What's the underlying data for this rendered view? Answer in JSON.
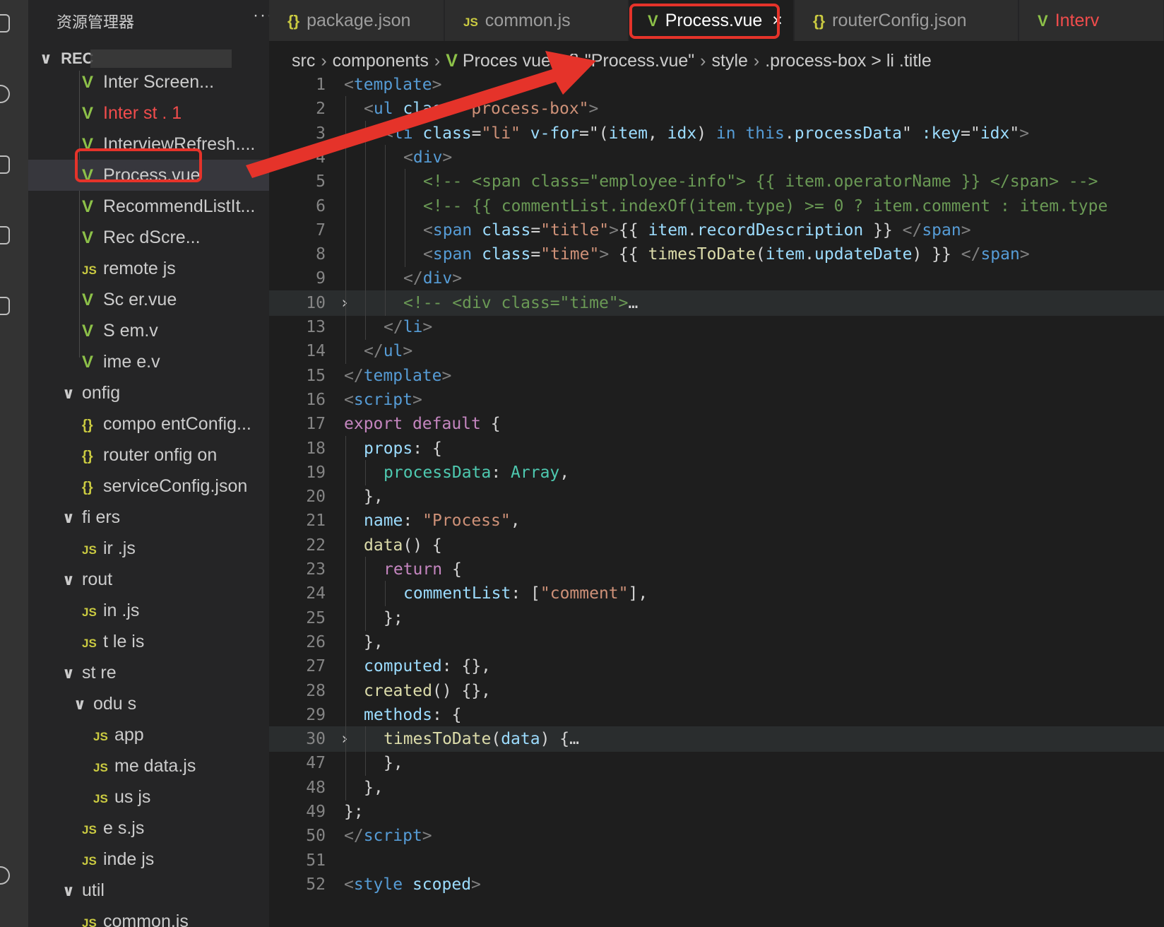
{
  "sidebar": {
    "title": "资源管理器",
    "more": "···",
    "root": "REC",
    "items": [
      {
        "icon": "vue",
        "label": "Inter   Screen...",
        "indent": 1
      },
      {
        "icon": "vue",
        "label": "Inter   st  .  1",
        "indent": 1,
        "error": true
      },
      {
        "icon": "vue",
        "label": "InterviewRefresh....",
        "indent": 1
      },
      {
        "icon": "vue",
        "label": "Process.vue",
        "indent": 1,
        "active": true
      },
      {
        "icon": "vue",
        "label": "RecommendListIt...",
        "indent": 1
      },
      {
        "icon": "vue",
        "label": "Rec   dScre...",
        "indent": 1
      },
      {
        "icon": "js",
        "label": "remote     js",
        "indent": 1
      },
      {
        "icon": "vue",
        "label": "Sc    er.vue",
        "indent": 1
      },
      {
        "icon": "vue",
        "label": "S   em.v",
        "indent": 1
      },
      {
        "icon": "vue",
        "label": "ime    e.v",
        "indent": 1
      },
      {
        "icon": "folder",
        "label": "onfig",
        "indent": 0
      },
      {
        "icon": "json",
        "label": "compo  entConfig...",
        "indent": 1
      },
      {
        "icon": "json",
        "label": "router  onfig  on",
        "indent": 1
      },
      {
        "icon": "json",
        "label": "serviceConfig.json",
        "indent": 1
      },
      {
        "icon": "folder",
        "label": "fi  ers",
        "indent": 0
      },
      {
        "icon": "js",
        "label": "ir    .js",
        "indent": 1
      },
      {
        "icon": "folder",
        "label": "rout",
        "indent": 0
      },
      {
        "icon": "js",
        "label": "in    .js",
        "indent": 1
      },
      {
        "icon": "js",
        "label": "t   le  is",
        "indent": 1
      },
      {
        "icon": "folder",
        "label": "st  re",
        "indent": 0
      },
      {
        "icon": "folder",
        "label": "odu   s",
        "indent": 1
      },
      {
        "icon": "js",
        "label": "app",
        "indent": 2
      },
      {
        "icon": "js",
        "label": "me   data.js",
        "indent": 2
      },
      {
        "icon": "js",
        "label": "us    js",
        "indent": 2
      },
      {
        "icon": "js",
        "label": "e    s.js",
        "indent": 1
      },
      {
        "icon": "js",
        "label": "inde   js",
        "indent": 1
      },
      {
        "icon": "folder",
        "label": "util",
        "indent": 0
      },
      {
        "icon": "js",
        "label": "common.js",
        "indent": 1
      }
    ]
  },
  "tabs": [
    {
      "icon": "json",
      "label": "package.json"
    },
    {
      "icon": "js",
      "label": "common.js"
    },
    {
      "icon": "vue",
      "label": "Process.vue",
      "active": true,
      "close": "×"
    },
    {
      "icon": "json",
      "label": "routerConfig.json"
    },
    {
      "icon": "vue",
      "label": "Interv"
    }
  ],
  "breadcrumb": [
    "src",
    "components",
    "Proces   vue",
    "{} \"Process.vue\"",
    "style",
    ".process-box > li .title"
  ],
  "icons": {
    "vue": "V",
    "js": "JS",
    "json": "{}",
    "folder": "∨",
    "fold": "〉"
  },
  "code": [
    {
      "n": "1",
      "tokens": [
        [
          "t-br",
          "<"
        ],
        [
          "t-tag",
          "template"
        ],
        [
          "t-br",
          ">"
        ]
      ],
      "indent": 0
    },
    {
      "n": "2",
      "tokens": [
        [
          "t-br",
          "<"
        ],
        [
          "t-tag",
          "ul "
        ],
        [
          "t-attr",
          "class"
        ],
        [
          "t-pl",
          "="
        ],
        [
          "t-str",
          "\"process-box\""
        ],
        [
          "t-br",
          ">"
        ]
      ],
      "indent": 1
    },
    {
      "n": "3",
      "tokens": [
        [
          "t-br",
          "<"
        ],
        [
          "t-tag",
          "li "
        ],
        [
          "t-attr",
          "class"
        ],
        [
          "t-pl",
          "="
        ],
        [
          "t-str",
          "\"li\" "
        ],
        [
          "t-attr",
          "v-for"
        ],
        [
          "t-pl",
          "=\"("
        ],
        [
          "t-prop",
          "item"
        ],
        [
          "t-pl",
          ", "
        ],
        [
          "t-prop",
          "idx"
        ],
        [
          "t-pl",
          ") "
        ],
        [
          "t-this",
          "in "
        ],
        [
          "t-this",
          "this"
        ],
        [
          "t-pl",
          "."
        ],
        [
          "t-prop",
          "processData"
        ],
        [
          "t-pl",
          "\" "
        ],
        [
          "t-attr",
          ":key"
        ],
        [
          "t-pl",
          "=\""
        ],
        [
          "t-prop",
          "idx"
        ],
        [
          "t-pl",
          "\""
        ],
        [
          "t-br",
          ">"
        ]
      ],
      "indent": 2
    },
    {
      "n": "4",
      "tokens": [
        [
          "t-br",
          "<"
        ],
        [
          "t-tag",
          "div"
        ],
        [
          "t-br",
          ">"
        ]
      ],
      "indent": 3
    },
    {
      "n": "5",
      "tokens": [
        [
          "t-cm",
          "<!-- <span class=\"employee-info\"> {{ item.operatorName }} </span> -->"
        ]
      ],
      "indent": 4
    },
    {
      "n": "6",
      "tokens": [
        [
          "t-cm",
          "<!-- {{ commentList.indexOf(item.type) >= 0 ? item.comment : item.type"
        ]
      ],
      "indent": 4
    },
    {
      "n": "7",
      "tokens": [
        [
          "t-br",
          "<"
        ],
        [
          "t-tag",
          "span "
        ],
        [
          "t-attr",
          "class"
        ],
        [
          "t-pl",
          "="
        ],
        [
          "t-str",
          "\"title\""
        ],
        [
          "t-br",
          ">"
        ],
        [
          "t-pl",
          "{{ "
        ],
        [
          "t-prop",
          "item"
        ],
        [
          "t-pl",
          "."
        ],
        [
          "t-prop",
          "recordDescription"
        ],
        [
          "t-pl",
          " }} "
        ],
        [
          "t-br",
          "</"
        ],
        [
          "t-tag",
          "span"
        ],
        [
          "t-br",
          ">"
        ]
      ],
      "indent": 4
    },
    {
      "n": "8",
      "tokens": [
        [
          "t-br",
          "<"
        ],
        [
          "t-tag",
          "span "
        ],
        [
          "t-attr",
          "class"
        ],
        [
          "t-pl",
          "="
        ],
        [
          "t-str",
          "\"time\""
        ],
        [
          "t-br",
          ">"
        ],
        [
          "t-pl",
          " {{ "
        ],
        [
          "t-fn",
          "timesToDate"
        ],
        [
          "t-pl",
          "("
        ],
        [
          "t-prop",
          "item"
        ],
        [
          "t-pl",
          "."
        ],
        [
          "t-prop",
          "updateDate"
        ],
        [
          "t-pl",
          ") }} "
        ],
        [
          "t-br",
          "</"
        ],
        [
          "t-tag",
          "span"
        ],
        [
          "t-br",
          ">"
        ]
      ],
      "indent": 4
    },
    {
      "n": "9",
      "tokens": [
        [
          "t-br",
          "</"
        ],
        [
          "t-tag",
          "div"
        ],
        [
          "t-br",
          ">"
        ]
      ],
      "indent": 3
    },
    {
      "n": "10",
      "tokens": [
        [
          "t-cm",
          "<!-- <div class=\"time\">"
        ],
        [
          "t-pl",
          "…"
        ]
      ],
      "indent": 3,
      "fold": true,
      "hl": true
    },
    {
      "n": "13",
      "tokens": [
        [
          "t-br",
          "</"
        ],
        [
          "t-tag",
          "li"
        ],
        [
          "t-br",
          ">"
        ]
      ],
      "indent": 2
    },
    {
      "n": "14",
      "tokens": [
        [
          "t-br",
          "</"
        ],
        [
          "t-tag",
          "ul"
        ],
        [
          "t-br",
          ">"
        ]
      ],
      "indent": 1
    },
    {
      "n": "15",
      "tokens": [
        [
          "t-br",
          "</"
        ],
        [
          "t-tag",
          "template"
        ],
        [
          "t-br",
          ">"
        ]
      ],
      "indent": 0
    },
    {
      "n": "16",
      "tokens": [
        [
          "t-br",
          "<"
        ],
        [
          "t-tag",
          "script"
        ],
        [
          "t-br",
          ">"
        ]
      ],
      "indent": 0
    },
    {
      "n": "17",
      "tokens": [
        [
          "t-kw",
          "export "
        ],
        [
          "t-kw",
          "default "
        ],
        [
          "t-pl",
          "{"
        ]
      ],
      "indent": 0
    },
    {
      "n": "18",
      "tokens": [
        [
          "t-prop",
          "props"
        ],
        [
          "t-pl",
          ": {"
        ]
      ],
      "indent": 1
    },
    {
      "n": "19",
      "tokens": [
        [
          "t-type",
          "processData"
        ],
        [
          "t-pl",
          ": "
        ],
        [
          "t-type",
          "Array"
        ],
        [
          "t-pl",
          ","
        ]
      ],
      "indent": 2
    },
    {
      "n": "20",
      "tokens": [
        [
          "t-pl",
          "},"
        ]
      ],
      "indent": 1
    },
    {
      "n": "21",
      "tokens": [
        [
          "t-prop",
          "name"
        ],
        [
          "t-pl",
          ": "
        ],
        [
          "t-str",
          "\"Process\""
        ],
        [
          "t-pl",
          ","
        ]
      ],
      "indent": 1
    },
    {
      "n": "22",
      "tokens": [
        [
          "t-fn",
          "data"
        ],
        [
          "t-pl",
          "() {"
        ]
      ],
      "indent": 1
    },
    {
      "n": "23",
      "tokens": [
        [
          "t-kw",
          "return "
        ],
        [
          "t-pl",
          "{"
        ]
      ],
      "indent": 2
    },
    {
      "n": "24",
      "tokens": [
        [
          "t-prop",
          "commentList"
        ],
        [
          "t-pl",
          ": ["
        ],
        [
          "t-str",
          "\"comment\""
        ],
        [
          "t-pl",
          "],"
        ]
      ],
      "indent": 3
    },
    {
      "n": "25",
      "tokens": [
        [
          "t-pl",
          "};"
        ]
      ],
      "indent": 2
    },
    {
      "n": "26",
      "tokens": [
        [
          "t-pl",
          "},"
        ]
      ],
      "indent": 1
    },
    {
      "n": "27",
      "tokens": [
        [
          "t-prop",
          "computed"
        ],
        [
          "t-pl",
          ": {},"
        ]
      ],
      "indent": 1
    },
    {
      "n": "28",
      "tokens": [
        [
          "t-fn",
          "created"
        ],
        [
          "t-pl",
          "() {},"
        ]
      ],
      "indent": 1
    },
    {
      "n": "29",
      "tokens": [
        [
          "t-prop",
          "methods"
        ],
        [
          "t-pl",
          ": {"
        ]
      ],
      "indent": 1
    },
    {
      "n": "30",
      "tokens": [
        [
          "t-fn",
          "timesToDate"
        ],
        [
          "t-pl",
          "("
        ],
        [
          "t-prop",
          "data"
        ],
        [
          "t-pl",
          ") {"
        ],
        [
          "t-pl",
          "…"
        ]
      ],
      "indent": 2,
      "fold": true,
      "hl": true
    },
    {
      "n": "47",
      "tokens": [
        [
          "t-pl",
          "},"
        ]
      ],
      "indent": 2
    },
    {
      "n": "48",
      "tokens": [
        [
          "t-pl",
          "},"
        ]
      ],
      "indent": 1
    },
    {
      "n": "49",
      "tokens": [
        [
          "t-pl",
          "};"
        ]
      ],
      "indent": 0
    },
    {
      "n": "50",
      "tokens": [
        [
          "t-br",
          "</"
        ],
        [
          "t-tag",
          "script"
        ],
        [
          "t-br",
          ">"
        ]
      ],
      "indent": 0
    },
    {
      "n": "51",
      "tokens": [],
      "indent": 0
    },
    {
      "n": "52",
      "tokens": [
        [
          "t-br",
          "<"
        ],
        [
          "t-tag",
          "style "
        ],
        [
          "t-attr",
          "scoped"
        ],
        [
          "t-br",
          ">"
        ]
      ],
      "indent": 0
    }
  ],
  "colors": {
    "annotation": "#e5332a",
    "vue": "#8dc149",
    "js": "#cbcb41",
    "error": "#f14c4c"
  }
}
